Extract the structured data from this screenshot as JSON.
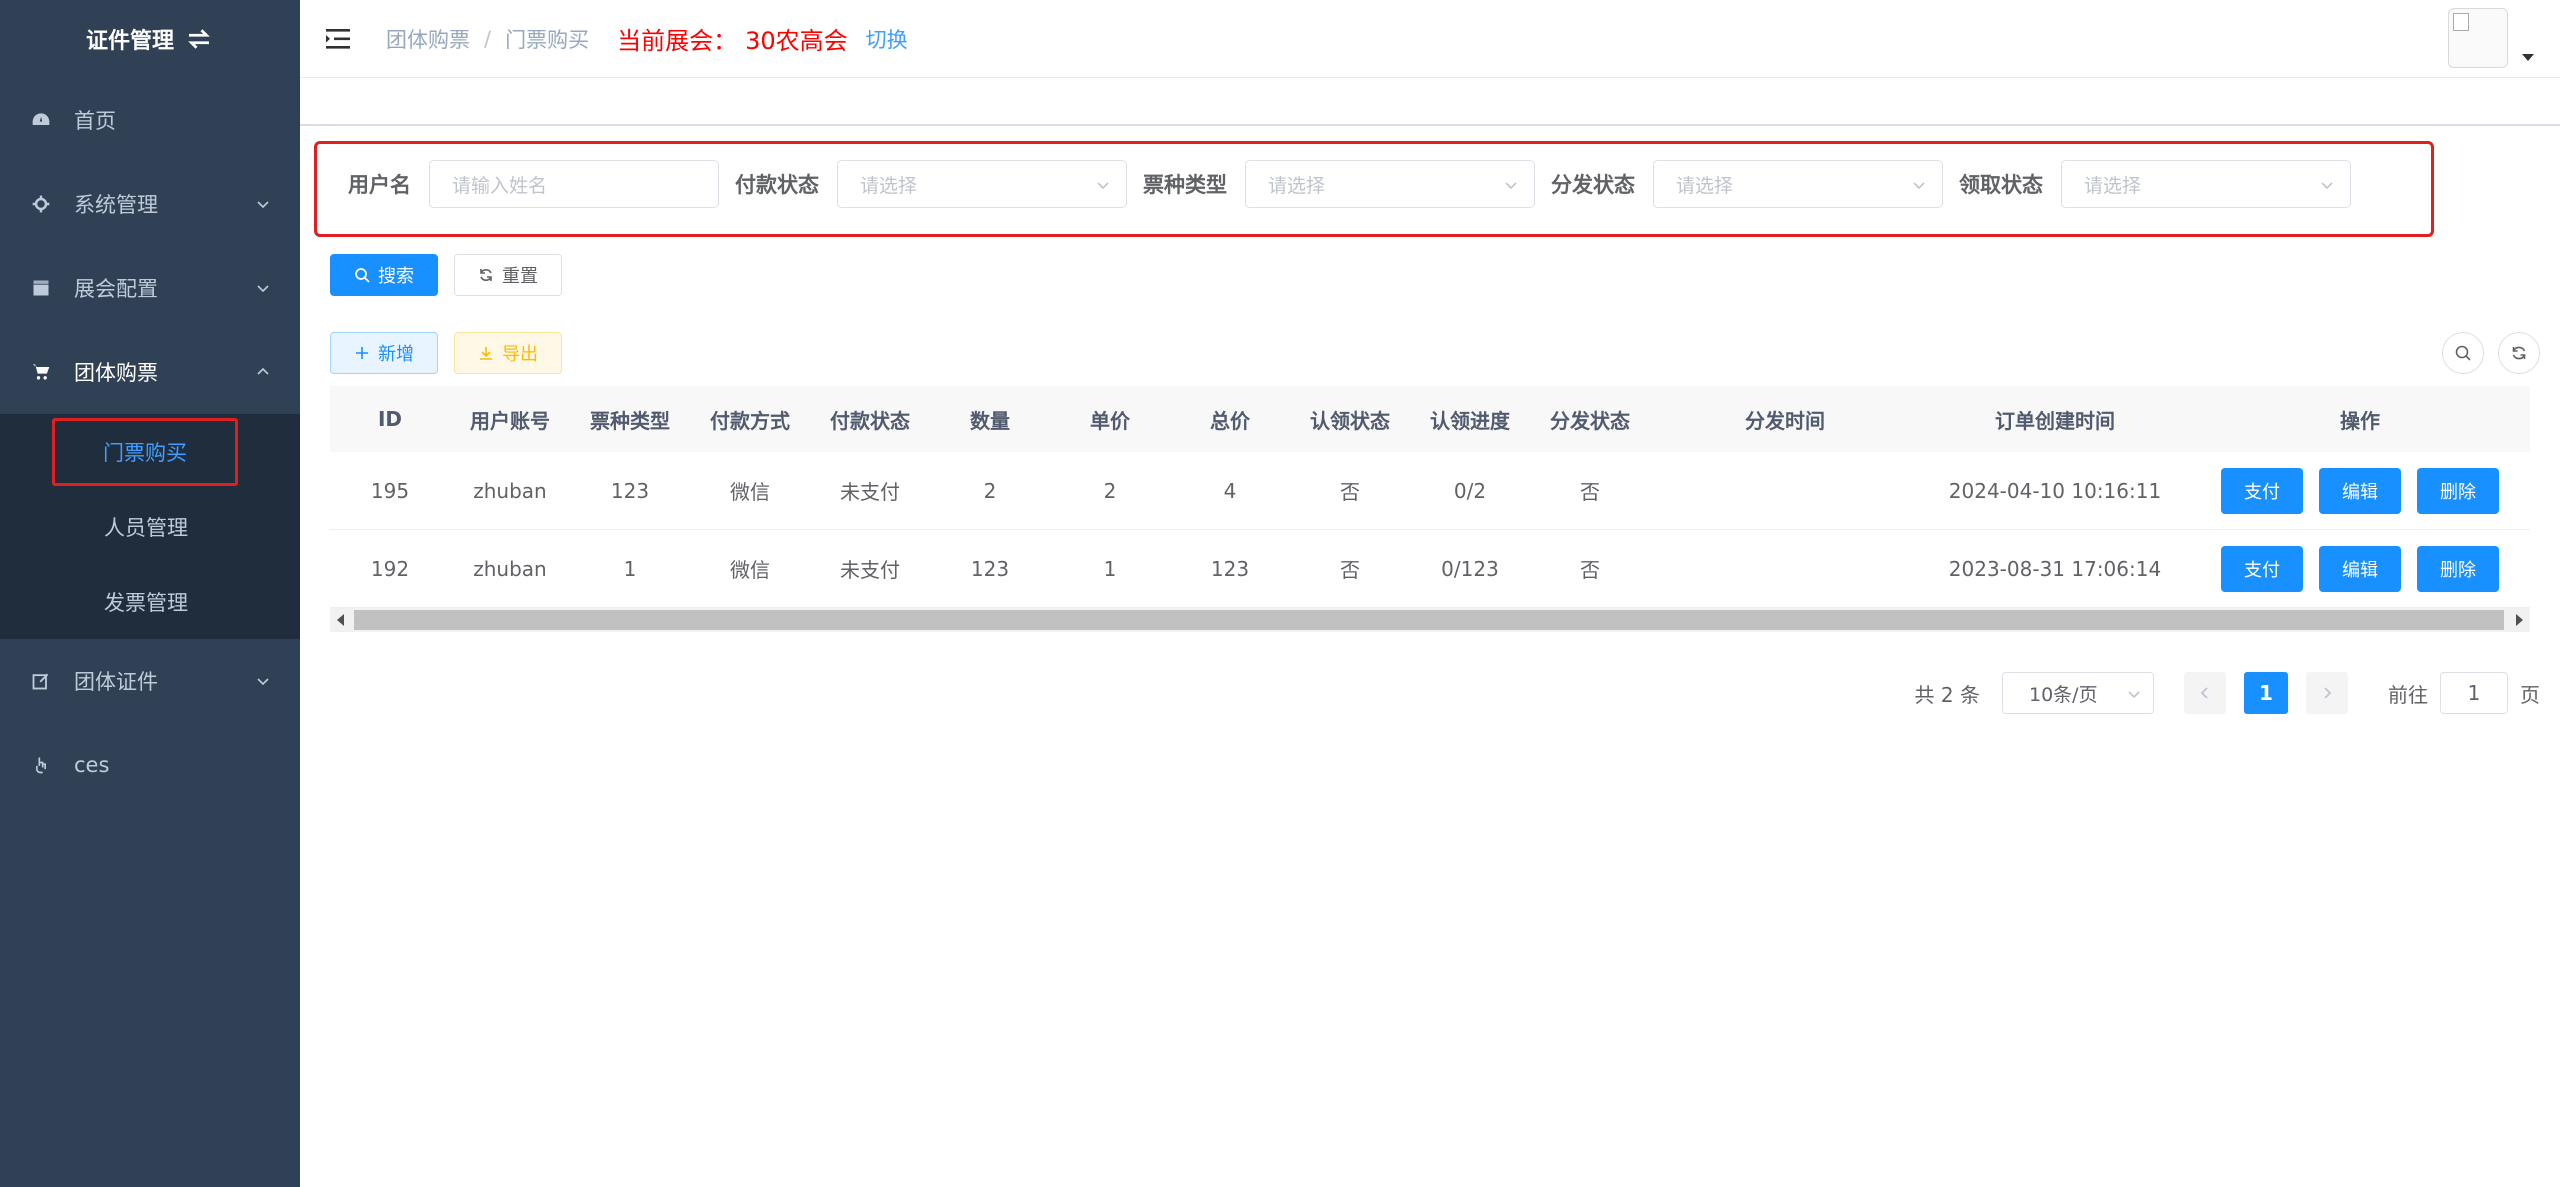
{
  "sidebar": {
    "logo": "证件管理",
    "items": [
      {
        "label": "首页"
      },
      {
        "label": "系统管理"
      },
      {
        "label": "展会配置"
      },
      {
        "label": "团体购票"
      },
      {
        "label": "团体证件"
      },
      {
        "label": "ces"
      }
    ],
    "sub_items": [
      {
        "label": "门票购买"
      },
      {
        "label": "人员管理"
      },
      {
        "label": "发票管理"
      }
    ]
  },
  "header": {
    "breadcrumb": [
      "团体购票",
      "门票购买"
    ],
    "breadcrumb_sep": "/",
    "expo_label": "当前展会：",
    "expo_name": "30农高会",
    "switch": "切换"
  },
  "filters": {
    "username_label": "用户名",
    "username_placeholder": "请输入姓名",
    "pay_status_label": "付款状态",
    "ticket_type_label": "票种类型",
    "dist_status_label": "分发状态",
    "claim_status_label": "领取状态",
    "select_placeholder": "请选择"
  },
  "buttons": {
    "search": "搜索",
    "reset": "重置",
    "add": "新增",
    "export": "导出"
  },
  "table": {
    "headers": [
      "ID",
      "用户账号",
      "票种类型",
      "付款方式",
      "付款状态",
      "数量",
      "单价",
      "总价",
      "认领状态",
      "认领进度",
      "分发状态",
      "分发时间",
      "订单创建时间",
      "操作"
    ],
    "rows": [
      {
        "id": "195",
        "user": "zhuban",
        "type": "123",
        "pay": "微信",
        "ps": "未支付",
        "qty": "2",
        "price": "2",
        "total": "4",
        "claim": "否",
        "prog": "0/2",
        "dist": "否",
        "dtime": "",
        "ctime": "2024-04-10 10:16:11"
      },
      {
        "id": "192",
        "user": "zhuban",
        "type": "1",
        "pay": "微信",
        "ps": "未支付",
        "qty": "123",
        "price": "1",
        "total": "123",
        "claim": "否",
        "prog": "0/123",
        "dist": "否",
        "dtime": "",
        "ctime": "2023-08-31 17:06:14"
      }
    ],
    "ops": {
      "pay": "支付",
      "edit": "编辑",
      "delete": "删除"
    }
  },
  "pagination": {
    "total": "共 2 条",
    "page_size": "10条/页",
    "current": "1",
    "goto_label": "前往",
    "goto_value": "1",
    "page_suffix": "页"
  },
  "colors": {
    "primary": "#1890ff",
    "sidebar": "#304156",
    "highlight": "#e02020",
    "expo": "#ff0000"
  }
}
